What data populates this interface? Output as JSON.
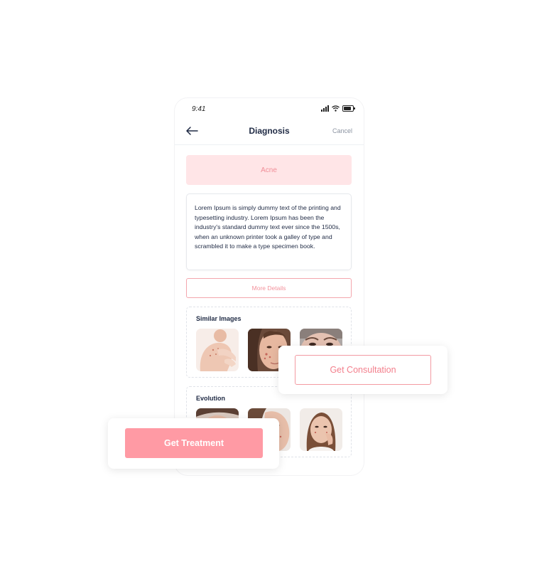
{
  "status_bar": {
    "time": "9:41"
  },
  "header": {
    "title": "Diagnosis",
    "cancel_label": "Cancel"
  },
  "diagnosis": {
    "name": "Acne"
  },
  "description": {
    "text": "Lorem Ipsum is simply dummy text of the printing and typesetting industry. Lorem Ipsum has been the industry's standard dummy text ever since the 1500s, when an unknown printer took a galley of type and scrambled it to make a type specimen book."
  },
  "more_details": {
    "label": "More Details"
  },
  "similar_images": {
    "title": "Similar Images"
  },
  "evolution": {
    "title": "Evolution"
  },
  "actions": {
    "consultation_label": "Get Consultation",
    "treatment_label": "Get Treatment"
  },
  "colors": {
    "accent": "#ff9aa4",
    "accent_light": "#ffe5e7",
    "text_dark": "#1f2a44",
    "muted": "#8b93a1"
  }
}
